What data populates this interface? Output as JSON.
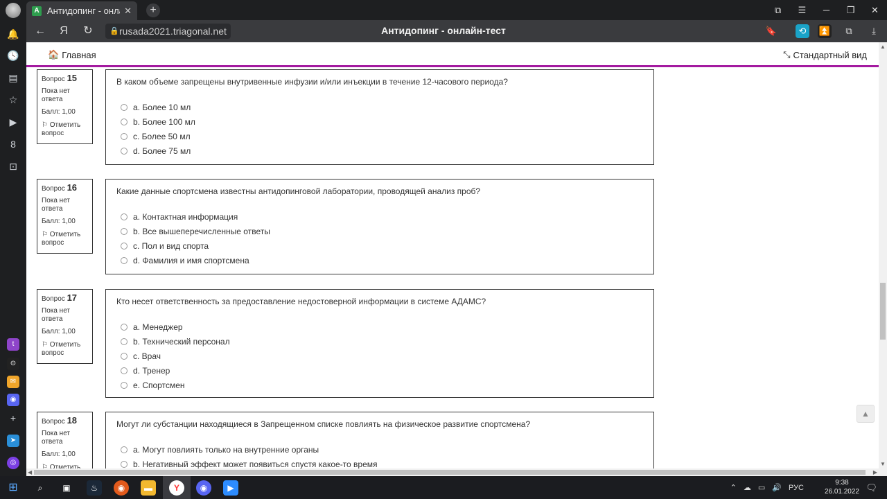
{
  "browser": {
    "tab_title": "Антидопинг - онлайн-т",
    "tab_favicon_text": "A",
    "url": "rusada2021.triagonal.net",
    "page_title": "Антидопинг - онлайн-тест"
  },
  "site_nav": {
    "home_label": "Главная",
    "std_view_label": "Стандартный вид"
  },
  "labels": {
    "question": "Вопрос",
    "not_answered": "Пока нет ответа",
    "flag": "Отметить вопрос"
  },
  "questions": [
    {
      "number": "15",
      "score": "Балл: 1,00",
      "text": "В каком объеме запрещены внутривенные инфузии и/или инъекции в течение 12-часового периода?",
      "options": [
        "a. Более 10 мл",
        "b. Более 100 мл",
        "c. Более 50 мл",
        "d. Более 75 мл"
      ]
    },
    {
      "number": "16",
      "score": "Балл: 1,00",
      "text": "Какие данные спортсмена известны антидопинговой лаборатории, проводящей анализ проб?",
      "options": [
        "a. Контактная информация",
        "b. Все вышеперечисленные ответы",
        "c. Пол и вид спорта",
        "d. Фамилия и имя спортсмена"
      ]
    },
    {
      "number": "17",
      "score": "Балл: 1,00",
      "text": "Кто несет ответственность за предоставление недостоверной информации в системе АДАМС?",
      "options": [
        "a. Менеджер",
        "b. Технический персонал",
        "c. Врач",
        "d. Тренер",
        "e. Спортсмен"
      ]
    },
    {
      "number": "18",
      "score": "Балл: 1,00",
      "text": "Могут ли субстанции находящиеся в Запрещенном списке повлиять на физическое развитие спортсмена?",
      "options": [
        "a. Могут повлиять только на внутренние органы",
        "b. Негативный эффект может появиться спустя какое-то время"
      ]
    }
  ],
  "taskbar": {
    "language": "РУС",
    "time": "9:38",
    "date": "26.01.2022"
  },
  "icons": {
    "home": "home-icon",
    "compress": "compress-icon",
    "flag": "flag-icon",
    "lock": "lock-icon"
  },
  "colors": {
    "nav_accent": "#a41aa0",
    "chrome_dark": "#1e1f21",
    "address_bar": "#3a3b3e"
  }
}
